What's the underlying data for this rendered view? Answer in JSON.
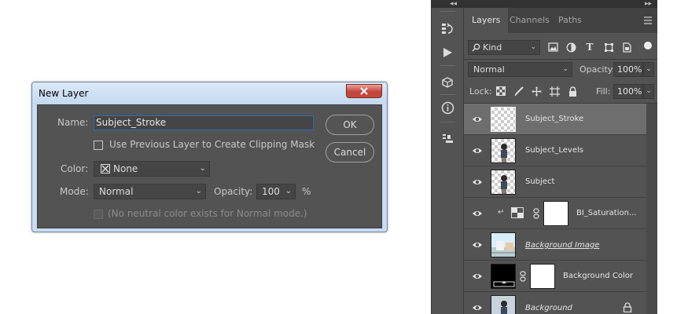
{
  "dialog": {
    "title": "New Layer",
    "name_label": "Name:",
    "name_value": "Subject_Stroke",
    "clipping_checkbox_label": "Use Previous Layer to Create Clipping Mask",
    "color_label": "Color:",
    "color_value": "None",
    "mode_label": "Mode:",
    "mode_value": "Normal",
    "opacity_label": "Opacity:",
    "opacity_value": "100",
    "opacity_unit": "%",
    "neutral_note": "(No neutral color exists for Normal mode.)",
    "ok_label": "OK",
    "cancel_label": "Cancel"
  },
  "panel": {
    "tabs": [
      {
        "label": "Layers",
        "active": true
      },
      {
        "label": "Channels",
        "active": false
      },
      {
        "label": "Paths",
        "active": false
      }
    ],
    "filter_value": "Kind",
    "blend_mode": "Normal",
    "opacity_label": "Opacity:",
    "opacity_value": "100%",
    "lock_label": "Lock:",
    "fill_label": "Fill:",
    "fill_value": "100%",
    "layers": [
      {
        "name": "Subject_Stroke",
        "selected": true,
        "thumb": "transparent"
      },
      {
        "name": "Subject_Levels",
        "selected": false,
        "thumb": "figure"
      },
      {
        "name": "Subject",
        "selected": false,
        "thumb": "figure"
      },
      {
        "name": "BI_Saturation...",
        "selected": false,
        "thumb": "adjustment"
      },
      {
        "name": "Background Image",
        "selected": false,
        "thumb": "photo"
      },
      {
        "name": "Background Color",
        "selected": false,
        "thumb": "black-with-mask"
      },
      {
        "name": "Background",
        "selected": false,
        "thumb": "figure-bg"
      }
    ]
  },
  "icons": [
    "close-icon",
    "history-icon",
    "play-icon",
    "cube-icon",
    "info-icon",
    "stamp-icon",
    "search-icon",
    "eye-icon",
    "link-icon",
    "lock-icon",
    "menu-icon"
  ],
  "colors": {
    "dialog_bg": "#535353",
    "panel_bg": "#535353",
    "selected_row": "#6e6e6e",
    "focus_blue": "#2c6ab8",
    "close_red": "#c4453b"
  }
}
